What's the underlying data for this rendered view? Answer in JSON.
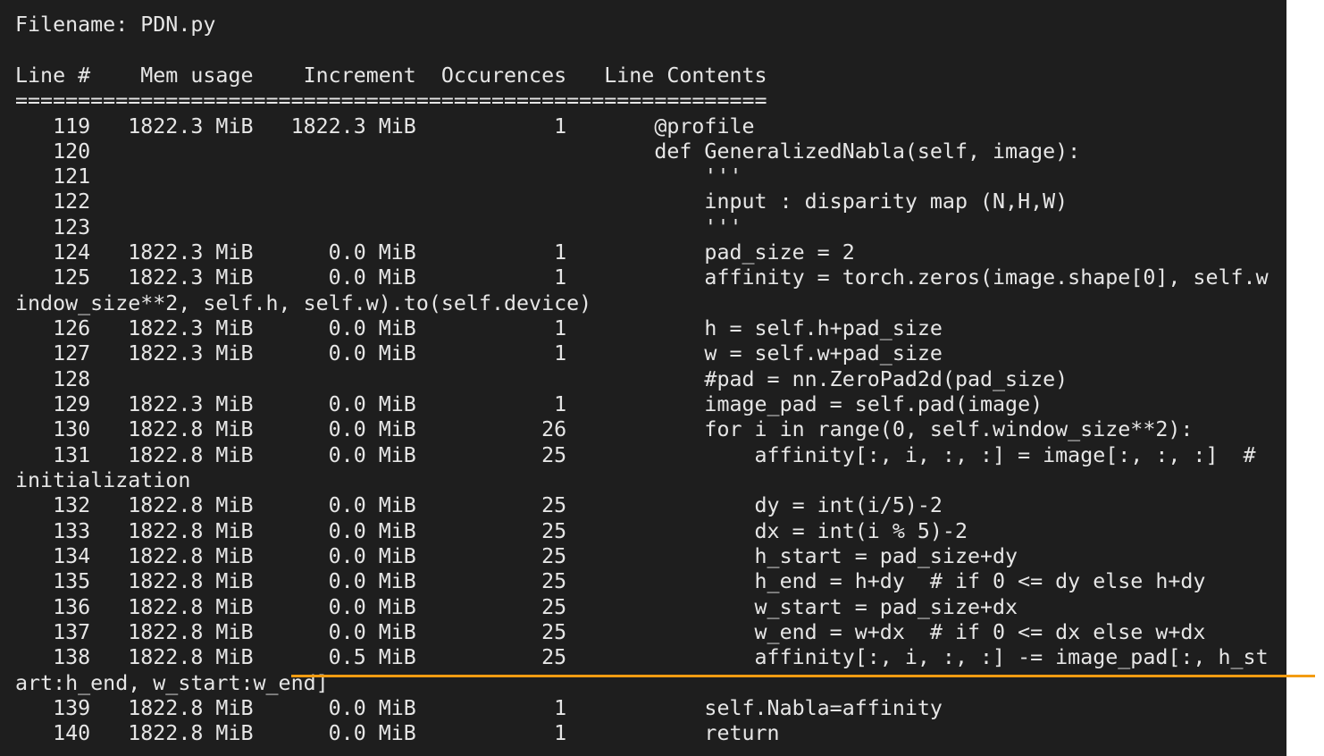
{
  "profiler": {
    "filename_line": "Filename: PDN.py",
    "header_line": "Line #    Mem usage    Increment  Occurences   Line Contents",
    "separator_line": "============================================================",
    "rows": [
      "   119   1822.3 MiB   1822.3 MiB           1       @profile",
      "   120                                             def GeneralizedNabla(self, image):",
      "   121                                                 '''",
      "   122                                                 input : disparity map (N,H,W)",
      "   123                                                 '''",
      "   124   1822.3 MiB      0.0 MiB           1           pad_size = 2",
      "   125   1822.3 MiB      0.0 MiB           1           affinity = torch.zeros(image.shape[0], self.w",
      "indow_size**2, self.h, self.w).to(self.device)",
      "   126   1822.3 MiB      0.0 MiB           1           h = self.h+pad_size",
      "   127   1822.3 MiB      0.0 MiB           1           w = self.w+pad_size",
      "   128                                                 #pad = nn.ZeroPad2d(pad_size)",
      "   129   1822.3 MiB      0.0 MiB           1           image_pad = self.pad(image)",
      "   130   1822.8 MiB      0.0 MiB          26           for i in range(0, self.window_size**2):",
      "   131   1822.8 MiB      0.0 MiB          25               affinity[:, i, :, :] = image[:, :, :]  #",
      "initialization",
      "   132   1822.8 MiB      0.0 MiB          25               dy = int(i/5)-2",
      "   133   1822.8 MiB      0.0 MiB          25               dx = int(i % 5)-2",
      "   134   1822.8 MiB      0.0 MiB          25               h_start = pad_size+dy",
      "   135   1822.8 MiB      0.0 MiB          25               h_end = h+dy  # if 0 <= dy else h+dy",
      "   136   1822.8 MiB      0.0 MiB          25               w_start = pad_size+dx",
      "   137   1822.8 MiB      0.0 MiB          25               w_end = w+dx  # if 0 <= dx else w+dx",
      "   138   1822.8 MiB      0.5 MiB          25               affinity[:, i, :, :] -= image_pad[:, h_st",
      "art:h_end, w_start:w_end]",
      "   139   1822.8 MiB      0.0 MiB           1           self.Nabla=affinity",
      "   140   1822.8 MiB      0.0 MiB           1           return"
    ]
  },
  "colors": {
    "background": "#1e1e1e",
    "text": "#e6e6e6",
    "highlight": "#f39c12"
  }
}
